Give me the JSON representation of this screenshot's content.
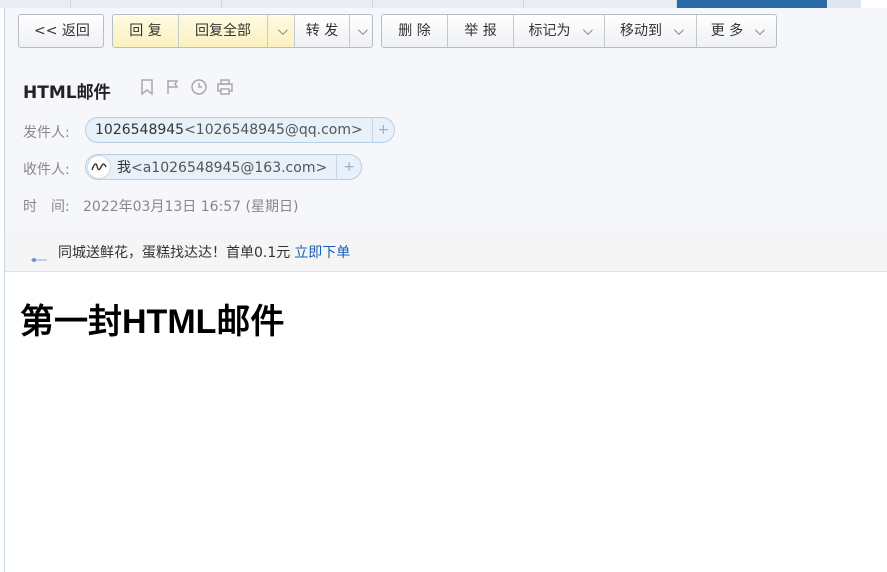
{
  "toolbar": {
    "back": "<< 返回",
    "reply": "回 复",
    "reply_all": "回复全部",
    "forward": "转 发",
    "delete": "删 除",
    "report": "举 报",
    "mark_as": "标记为",
    "move_to": "移动到",
    "more": "更 多"
  },
  "mail": {
    "subject": "HTML邮件",
    "sender_label": "发件人:",
    "sender_name": "1026548945",
    "sender_email": "<1026548945@qq.com>",
    "recipient_label": "收件人:",
    "recipient_name": "我",
    "recipient_email": "<a1026548945@163.com>",
    "time_label": "时　间:",
    "time_value": "2022年03月13日 16:57 (星期日)"
  },
  "ad": {
    "text": "同城送鲜花，蛋糕找达达！首单0.1元",
    "link": "立即下单"
  },
  "content": {
    "heading": "第一封HTML邮件"
  },
  "colors": {
    "accent_tab": "#2a6aa6",
    "link": "#1a5eb8",
    "reply_bg": "#fbf0c0"
  }
}
